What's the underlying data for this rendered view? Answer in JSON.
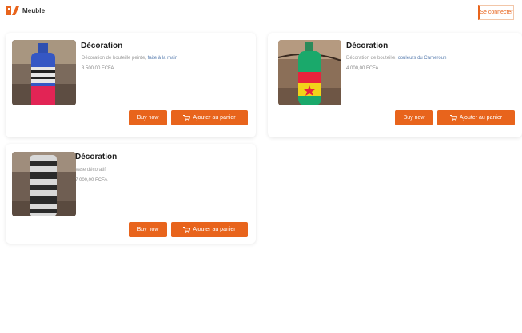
{
  "header": {
    "logo_text": "Meuble",
    "action_label": "Se connecter"
  },
  "theme": {
    "accent": "#e8641c"
  },
  "products": [
    {
      "title": "Décoration",
      "desc_main": "Décoration de bouteille peinte, ",
      "desc_accent": "faite à la main",
      "price": "3 500,00 FCFA",
      "buy_label": "Buy now",
      "cart_label": "Ajouter au panier",
      "image_icon": "blue-bottle-image"
    },
    {
      "title": "Décoration",
      "desc_main": "Décoration de bouteille, ",
      "desc_accent": "couleurs du Cameroun",
      "price": "4 000,00 FCFA",
      "buy_label": "Buy now",
      "cart_label": "Ajouter au panier",
      "image_icon": "green-bottle-image"
    },
    {
      "title": "Décoration",
      "desc_main": "Vase décoratif",
      "desc_accent": "",
      "price": "7 000,00 FCFA",
      "buy_label": "Buy now",
      "cart_label": "Ajouter au panier",
      "image_icon": "striped-vase-image"
    }
  ]
}
